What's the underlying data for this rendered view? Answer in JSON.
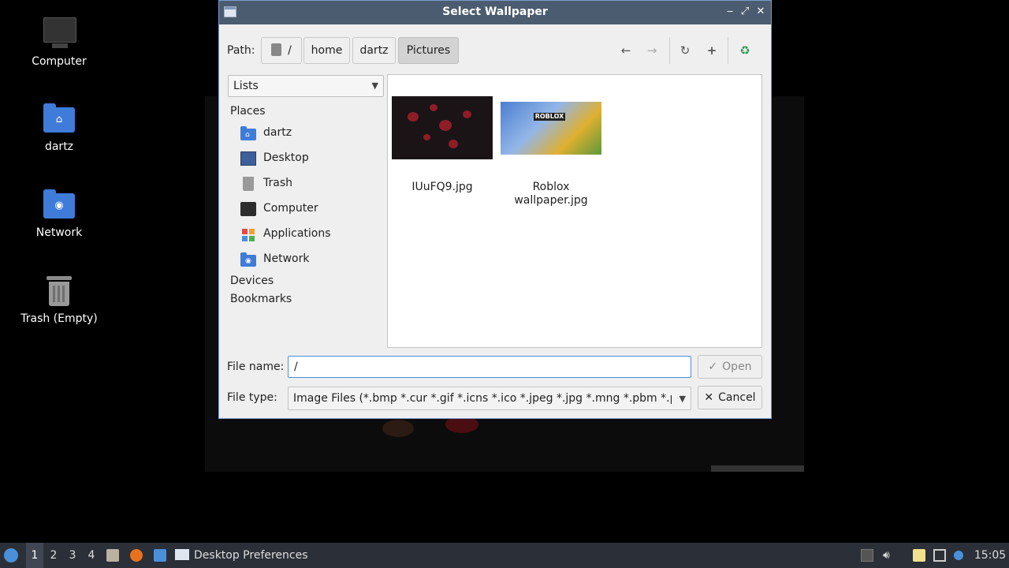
{
  "desktop": {
    "icons": [
      {
        "label": "Computer",
        "icon": "computer-icon"
      },
      {
        "label": "dartz",
        "icon": "home-folder-icon"
      },
      {
        "label": "Network",
        "icon": "network-folder-icon"
      },
      {
        "label": "Trash (Empty)",
        "icon": "trash-icon"
      }
    ]
  },
  "dialog": {
    "title": "Select Wallpaper",
    "path_label": "Path:",
    "breadcrumbs": [
      "/",
      "home",
      "dartz",
      "Pictures"
    ],
    "active_crumb": "Pictures",
    "toolbar": {
      "back": "←",
      "forward": "→",
      "reload": "↻",
      "new_folder": "+",
      "app": "app-icon"
    },
    "view_mode": "Lists",
    "sidebar": {
      "places_heading": "Places",
      "places": [
        "dartz",
        "Desktop",
        "Trash",
        "Computer",
        "Applications",
        "Network"
      ],
      "devices_heading": "Devices",
      "bookmarks_heading": "Bookmarks"
    },
    "files": [
      {
        "name": "IUuFQ9.jpg"
      },
      {
        "name_line1": "Roblox",
        "name_line2": "wallpaper.jpg",
        "thumb_text": "ROBLOX"
      }
    ],
    "file_name_label": "File name:",
    "file_name_value": "/",
    "open_label": "Open",
    "file_type_label": "File type:",
    "file_type_value": "Image Files (*.bmp *.cur *.gif *.icns *.ico *.jpeg *.jpg *.mng *.pbm *.pgm",
    "cancel_label": "Cancel"
  },
  "taskbar": {
    "workspaces": [
      "1",
      "2",
      "3",
      "4"
    ],
    "active_workspace": "1",
    "window_label": "Desktop Preferences",
    "clock": "15:05"
  },
  "colors": {
    "titlebar": "#4c5c70",
    "taskbar": "#2b2f37",
    "folder": "#3f7bd9",
    "focus_border": "#4a90d9"
  }
}
